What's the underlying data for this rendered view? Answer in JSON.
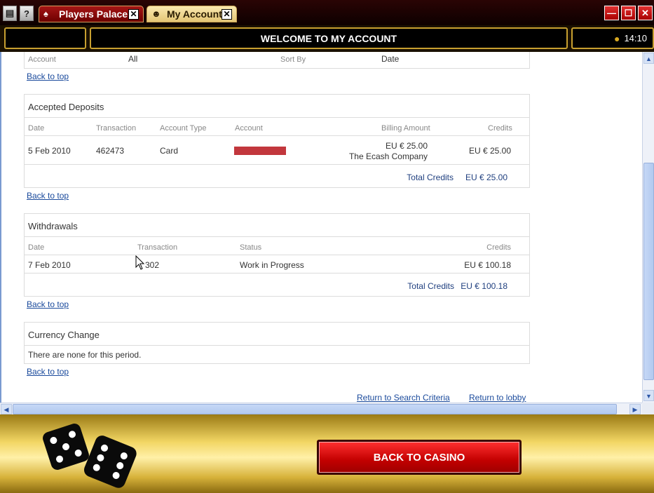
{
  "tabs": [
    {
      "label": "Players Palace",
      "close": "✕"
    },
    {
      "label": "My Account",
      "close": "✕"
    }
  ],
  "system_buttons": [
    "▤",
    "?"
  ],
  "window_buttons": [
    "—",
    "☐",
    "✕"
  ],
  "header": {
    "title": "WELCOME TO MY ACCOUNT",
    "time": "14:10"
  },
  "filter": {
    "account_label": "Account",
    "account_value": "All",
    "sort_label": "Sort By",
    "sort_value": "Date"
  },
  "back_to_top": "Back to top",
  "deposits": {
    "title": "Accepted Deposits",
    "columns": [
      "Date",
      "Transaction",
      "Account Type",
      "Account",
      "Billing Amount",
      "Credits"
    ],
    "row": {
      "date": "5 Feb 2010",
      "transaction": "462473",
      "account_type": "Card",
      "billing_amount": "EU € 25.00",
      "billing_company": "The Ecash Company",
      "credits": "EU € 25.00"
    },
    "total_label": "Total Credits",
    "total_value": "EU € 25.00"
  },
  "withdrawals": {
    "title": "Withdrawals",
    "columns": [
      "Date",
      "Transaction",
      "Status",
      "Credits"
    ],
    "row": {
      "date": "7 Feb 2010",
      "transaction": "302",
      "status": "Work in Progress",
      "credits": "EU € 100.18"
    },
    "total_label": "Total Credits",
    "total_value": "EU € 100.18"
  },
  "currency_change": {
    "title": "Currency Change",
    "message": "There are none for this period."
  },
  "links": {
    "return_search": "Return to Search Criteria",
    "return_lobby": "Return to lobby"
  },
  "footer": {
    "back_button": "BACK TO CASINO"
  },
  "colors": {
    "accent_red": "#c20000",
    "link_blue": "#1a4a9c",
    "gold": "#c8a030"
  }
}
